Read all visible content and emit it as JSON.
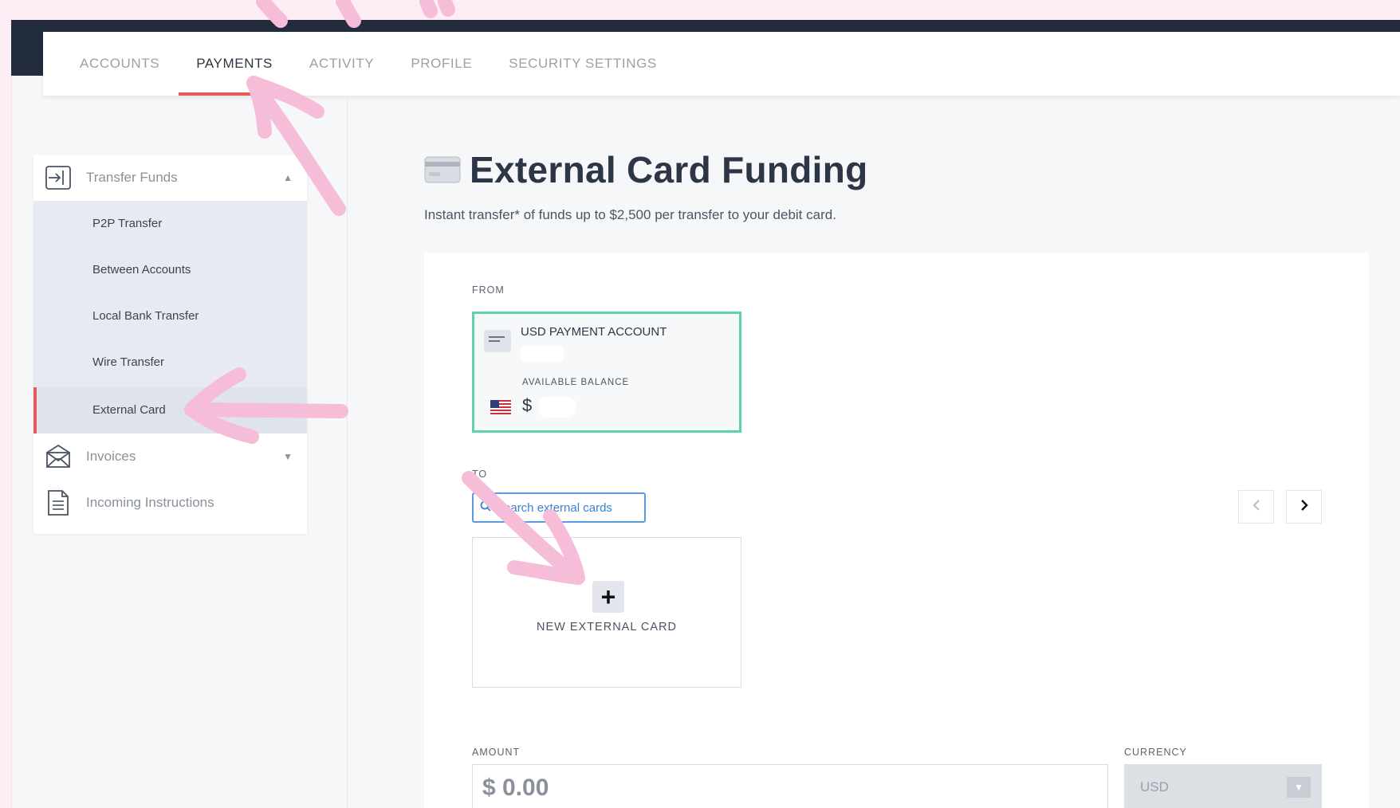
{
  "nav": {
    "tabs": [
      {
        "label": "ACCOUNTS"
      },
      {
        "label": "PAYMENTS"
      },
      {
        "label": "ACTIVITY"
      },
      {
        "label": "PROFILE"
      },
      {
        "label": "SECURITY SETTINGS"
      }
    ],
    "active_tab": "PAYMENTS"
  },
  "sidebar": {
    "transfer_funds": {
      "label": "Transfer Funds",
      "icon": "transfer-icon",
      "expanded": true,
      "items": [
        {
          "label": "P2P Transfer"
        },
        {
          "label": "Between Accounts"
        },
        {
          "label": "Local Bank Transfer"
        },
        {
          "label": "Wire Transfer"
        },
        {
          "label": "External Card"
        }
      ],
      "active_item": "External Card"
    },
    "invoices": {
      "label": "Invoices",
      "icon": "envelope-icon"
    },
    "incoming": {
      "label": "Incoming Instructions",
      "icon": "document-icon"
    }
  },
  "main": {
    "title": "External Card Funding",
    "subtitle": "Instant transfer* of funds up to $2,500 per transfer to your debit card.",
    "from": {
      "label": "FROM",
      "account_name": "USD PAYMENT ACCOUNT",
      "balance_label": "AVAILABLE BALANCE",
      "currency_symbol": "$"
    },
    "to": {
      "label": "TO",
      "search_placeholder": "Search external cards",
      "new_card_label": "NEW EXTERNAL CARD"
    },
    "amount": {
      "label": "AMOUNT",
      "value": "$ 0.00"
    },
    "currency": {
      "label": "CURRENCY",
      "value": "USD"
    }
  },
  "colors": {
    "accent": "#e25c5c",
    "selected_border": "#5fd3a8",
    "link": "#3b82d6",
    "annotation_arrow": "#f6bdd9"
  }
}
